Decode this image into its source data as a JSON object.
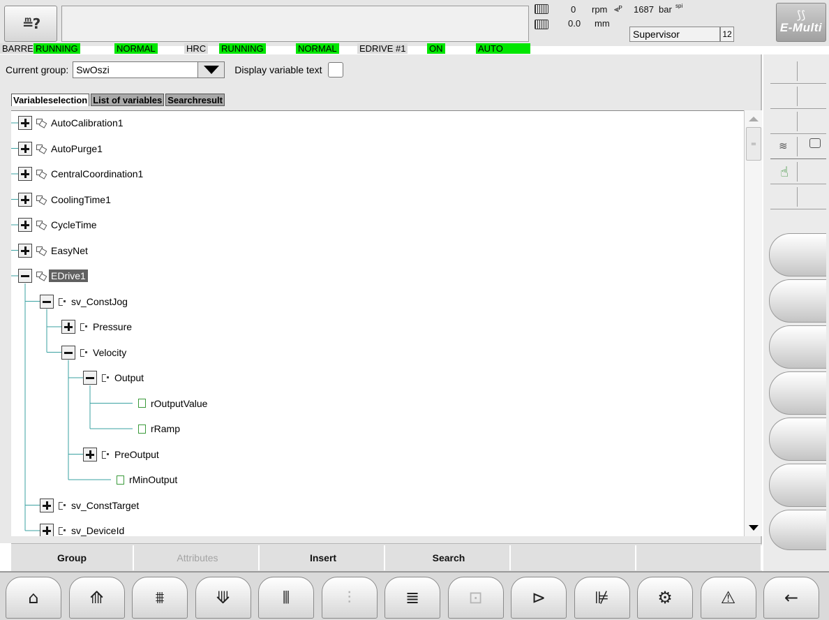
{
  "header": {
    "help_glyph": "≞?",
    "machine_status": {
      "screw_speed_value": "0",
      "screw_speed_unit": "rpm",
      "screw_pos_value": "0.0",
      "screw_pos_unit": "mm",
      "pressure_value": "1687",
      "pressure_unit": "bar",
      "pressure_unit_sup": "spi"
    },
    "user_name": "Supervisor",
    "user_level": "12",
    "logo_text": "E-Multi"
  },
  "status_bar": [
    {
      "text": "BARREL",
      "style": "lbl"
    },
    {
      "text": "RUNNING",
      "style": "grn"
    },
    {
      "text": "NORMAL",
      "style": "grn"
    },
    {
      "text": "HRC",
      "style": "lbl"
    },
    {
      "text": "RUNNING",
      "style": "grn"
    },
    {
      "text": "NORMAL",
      "style": "grn"
    },
    {
      "text": "EDRIVE #1",
      "style": "lbl"
    },
    {
      "text": "ON",
      "style": "grn"
    },
    {
      "text": "AUTO",
      "style": "grn"
    }
  ],
  "group": {
    "label": "Current group:",
    "value": "SwOszi",
    "display_text_label": "Display variable text",
    "display_text_checked": false
  },
  "tabs": [
    {
      "label": "Variableselection",
      "active": true
    },
    {
      "label": "List of variables",
      "active": false
    },
    {
      "label": "Searchresult",
      "active": false
    }
  ],
  "tree": [
    {
      "label": "AutoCalibration1",
      "depth": 0,
      "toggle": "plus",
      "icon": "group",
      "selected": false
    },
    {
      "label": "AutoPurge1",
      "depth": 0,
      "toggle": "plus",
      "icon": "group",
      "selected": false
    },
    {
      "label": "CentralCoordination1",
      "depth": 0,
      "toggle": "plus",
      "icon": "group",
      "selected": false
    },
    {
      "label": "CoolingTime1",
      "depth": 0,
      "toggle": "plus",
      "icon": "group",
      "selected": false
    },
    {
      "label": "CycleTime",
      "depth": 0,
      "toggle": "plus",
      "icon": "group",
      "selected": false
    },
    {
      "label": "EasyNet",
      "depth": 0,
      "toggle": "plus",
      "icon": "group",
      "selected": false
    },
    {
      "label": "EDrive1",
      "depth": 0,
      "toggle": "minus",
      "icon": "group",
      "selected": true
    },
    {
      "label": "sv_ConstJog",
      "depth": 1,
      "toggle": "minus",
      "icon": "struct",
      "selected": false
    },
    {
      "label": "Pressure",
      "depth": 2,
      "toggle": "plus",
      "icon": "struct",
      "selected": false
    },
    {
      "label": "Velocity",
      "depth": 2,
      "toggle": "minus",
      "icon": "struct",
      "selected": false
    },
    {
      "label": "Output",
      "depth": 3,
      "toggle": "minus",
      "icon": "struct",
      "selected": false
    },
    {
      "label": "rOutputValue",
      "depth": 4,
      "toggle": "none",
      "icon": "var",
      "selected": false
    },
    {
      "label": "rRamp",
      "depth": 4,
      "toggle": "none",
      "icon": "var",
      "selected": false
    },
    {
      "label": "PreOutput",
      "depth": 3,
      "toggle": "plus",
      "icon": "struct",
      "selected": false
    },
    {
      "label": "rMinOutput",
      "depth": 3,
      "toggle": "none",
      "icon": "var",
      "selected": false
    },
    {
      "label": "sv_ConstTarget",
      "depth": 1,
      "toggle": "plus",
      "icon": "struct",
      "selected": false
    },
    {
      "label": "sv_DeviceId",
      "depth": 1,
      "toggle": "plus",
      "icon": "struct",
      "selected": false
    }
  ],
  "function_keys": [
    {
      "label": "Group",
      "enabled": true
    },
    {
      "label": "Attributes",
      "enabled": false
    },
    {
      "label": "Insert",
      "enabled": true
    },
    {
      "label": "Search",
      "enabled": true
    },
    {
      "label": "",
      "enabled": true
    },
    {
      "label": "",
      "enabled": true
    }
  ],
  "right_panel": {
    "heating_icon": "heating-icon",
    "monitor_icon": "monitor-icon",
    "hand_icon": "hand-icon"
  },
  "bottom_nav": [
    {
      "icon": "home-icon",
      "glyph": "⌂",
      "enabled": true
    },
    {
      "icon": "mold-icon",
      "glyph": "⟰",
      "enabled": true
    },
    {
      "icon": "injection-icon",
      "glyph": "⩩",
      "enabled": true
    },
    {
      "icon": "ejector-icon",
      "glyph": "⟱",
      "enabled": true
    },
    {
      "icon": "heating-profile-icon",
      "glyph": "⫴",
      "enabled": true
    },
    {
      "icon": "quality-icon",
      "glyph": "⫶",
      "enabled": false
    },
    {
      "icon": "list-icon",
      "glyph": "≣",
      "enabled": true
    },
    {
      "icon": "robot-icon",
      "glyph": "⊡",
      "enabled": false
    },
    {
      "icon": "oscilloscope-icon",
      "glyph": "⊳",
      "enabled": true
    },
    {
      "icon": "chart-icon",
      "glyph": "⊯",
      "enabled": true
    },
    {
      "icon": "settings-icon",
      "glyph": "⚙",
      "enabled": true
    },
    {
      "icon": "alarm-icon",
      "glyph": "⚠",
      "enabled": true
    },
    {
      "icon": "back-icon",
      "glyph": "←",
      "enabled": true
    }
  ],
  "colors": {
    "status_green": "#00e600",
    "selection_bg": "#606060",
    "tree_line": "#3aa1a1"
  }
}
